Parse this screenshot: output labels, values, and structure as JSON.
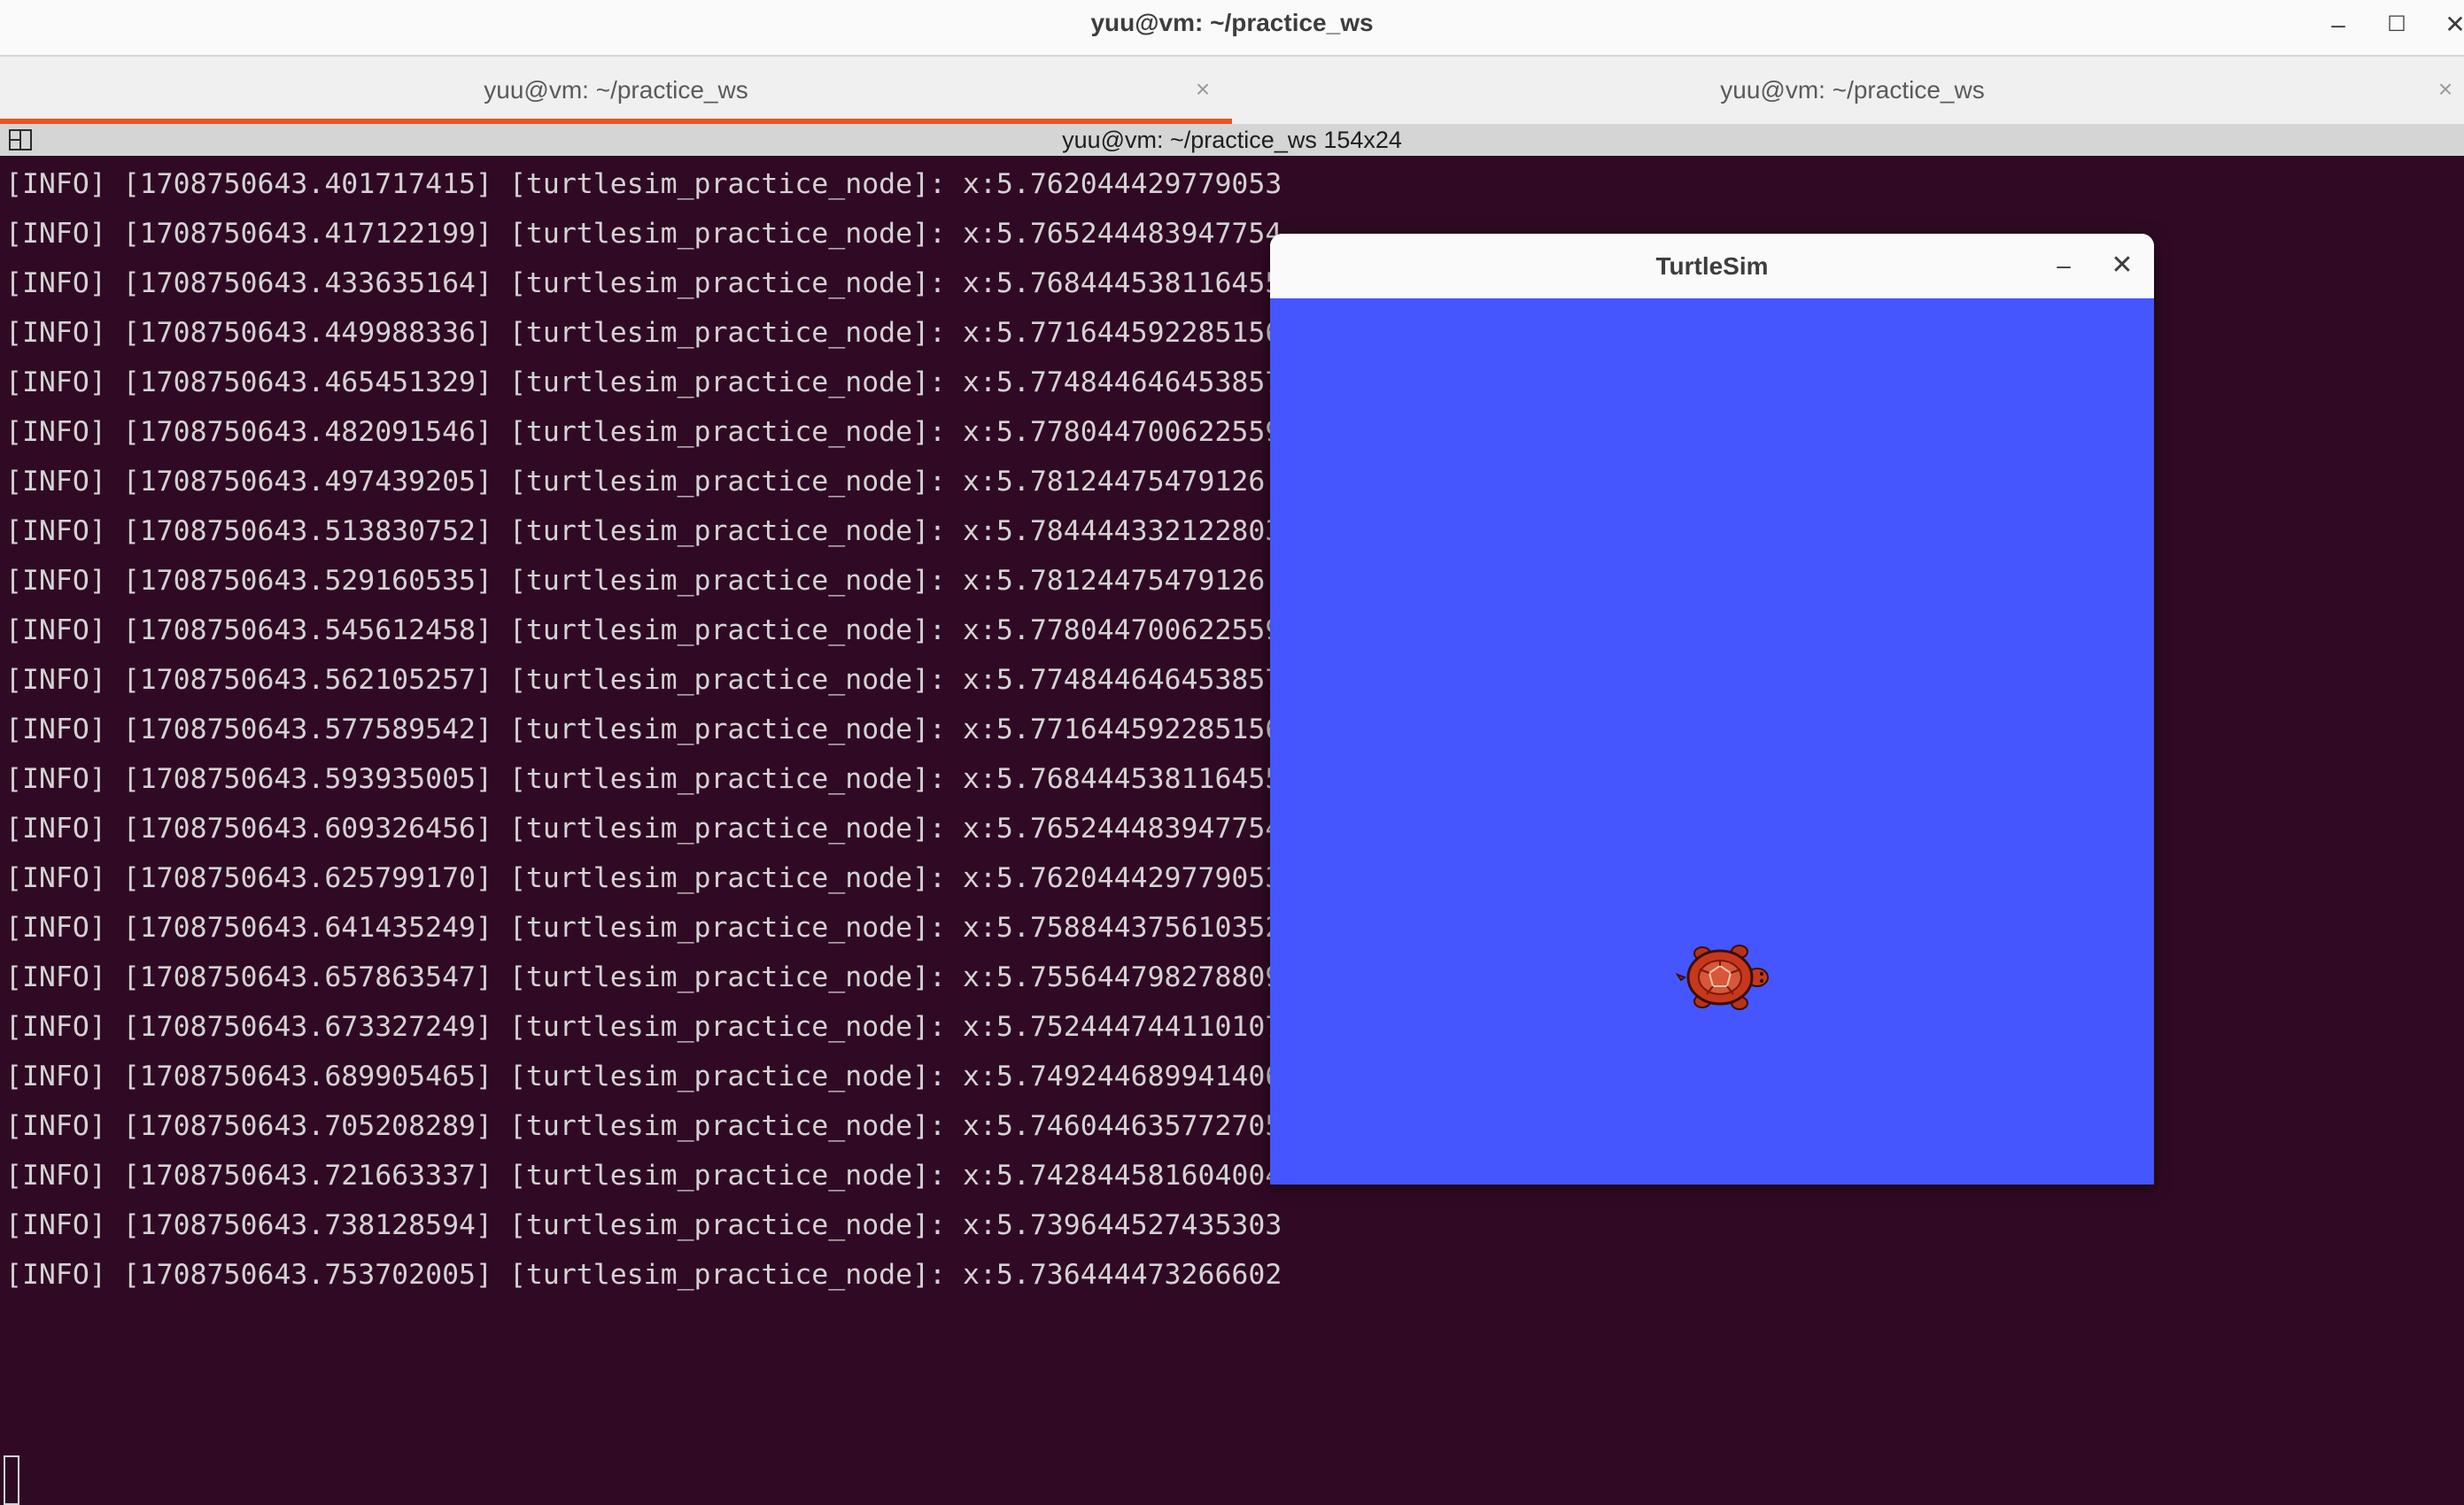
{
  "window": {
    "title": "yuu@vm: ~/practice_ws",
    "minimize_glyph": "–",
    "maximize_glyph": "☐",
    "close_glyph": "✕"
  },
  "tabs": [
    {
      "label": "yuu@vm: ~/practice_ws",
      "active": true,
      "close_glyph": "×"
    },
    {
      "label": "yuu@vm: ~/practice_ws",
      "active": false,
      "close_glyph": "×"
    }
  ],
  "terminal": {
    "header_title": "yuu@vm: ~/practice_ws 154x24",
    "header_icon": "split-terminal-icon",
    "lines": [
      "[INFO] [1708750643.401717415] [turtlesim_practice_node]: x:5.762044429779053",
      "[INFO] [1708750643.417122199] [turtlesim_practice_node]: x:5.765244483947754",
      "[INFO] [1708750643.433635164] [turtlesim_practice_node]: x:5.768444538116455",
      "[INFO] [1708750643.449988336] [turtlesim_practice_node]: x:5.771644592285156",
      "[INFO] [1708750643.465451329] [turtlesim_practice_node]: x:5.774844646453857",
      "[INFO] [1708750643.482091546] [turtlesim_practice_node]: x:5.778044700622559",
      "[INFO] [1708750643.497439205] [turtlesim_practice_node]: x:5.78124475479126",
      "[INFO] [1708750643.513830752] [turtlesim_practice_node]: x:5.784444332122803",
      "[INFO] [1708750643.529160535] [turtlesim_practice_node]: x:5.78124475479126",
      "[INFO] [1708750643.545612458] [turtlesim_practice_node]: x:5.778044700622559",
      "[INFO] [1708750643.562105257] [turtlesim_practice_node]: x:5.774844646453857",
      "[INFO] [1708750643.577589542] [turtlesim_practice_node]: x:5.771644592285156",
      "[INFO] [1708750643.593935005] [turtlesim_practice_node]: x:5.768444538116455",
      "[INFO] [1708750643.609326456] [turtlesim_practice_node]: x:5.765244483947754",
      "[INFO] [1708750643.625799170] [turtlesim_practice_node]: x:5.762044429779053",
      "[INFO] [1708750643.641435249] [turtlesim_practice_node]: x:5.758844375610352",
      "[INFO] [1708750643.657863547] [turtlesim_practice_node]: x:5.755644798278809",
      "[INFO] [1708750643.673327249] [turtlesim_practice_node]: x:5.752444744110107",
      "[INFO] [1708750643.689905465] [turtlesim_practice_node]: x:5.749244689941406",
      "[INFO] [1708750643.705208289] [turtlesim_practice_node]: x:5.746044635772705",
      "[INFO] [1708750643.721663337] [turtlesim_practice_node]: x:5.742844581604004",
      "[INFO] [1708750643.738128594] [turtlesim_practice_node]: x:5.739644527435303",
      "[INFO] [1708750643.753702005] [turtlesim_practice_node]: x:5.736444473266602"
    ]
  },
  "turtlesim": {
    "title": "TurtleSim",
    "minimize_glyph": "–",
    "close_glyph": "✕",
    "background_color": "#4556ff",
    "turtle_icon": "turtle-icon"
  },
  "colors": {
    "terminal_bg": "#300a24",
    "accent": "#e95420"
  }
}
